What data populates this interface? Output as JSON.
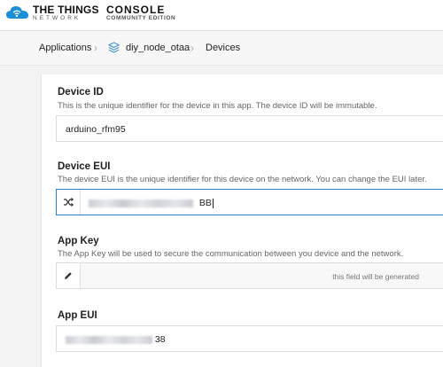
{
  "header": {
    "brand_title": "THE THINGS",
    "brand_sub": "NETWORK",
    "console_title": "CONSOLE",
    "console_sub": "COMMUNITY EDITION"
  },
  "breadcrumb": {
    "applications": "Applications",
    "app_name": "diy_node_otaa",
    "devices": "Devices"
  },
  "form": {
    "device_id": {
      "label": "Device ID",
      "description": "This is the unique identifier for the device in this app. The device ID will be immutable.",
      "value": "arduino_rfm95"
    },
    "device_eui": {
      "label": "Device EUI",
      "description": "The device EUI is the unique identifier for this device on the network. You can change the EUI later.",
      "value_suffix": "BB"
    },
    "app_key": {
      "label": "App Key",
      "description": "The App Key will be used to secure the communication between you device and the network.",
      "placeholder": "this field will be generated"
    },
    "app_eui": {
      "label": "App EUI",
      "value_suffix": "38"
    }
  }
}
